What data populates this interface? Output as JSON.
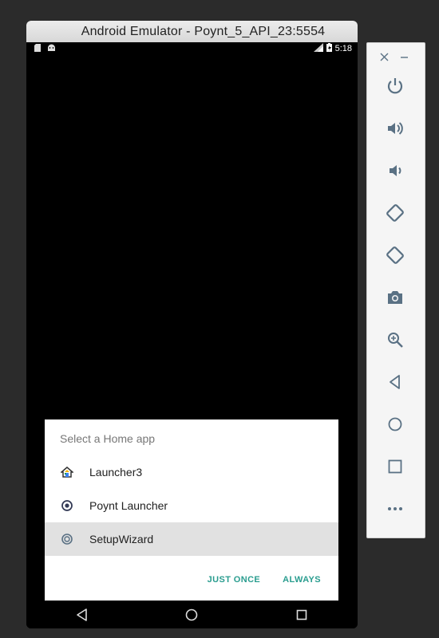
{
  "window": {
    "title": "Android Emulator - Poynt_5_API_23:5554"
  },
  "status_bar": {
    "time": "5:18",
    "left_icons": [
      "sd-card-icon",
      "android-icon"
    ],
    "right_icons": [
      "signal-icon",
      "battery-charging-icon"
    ]
  },
  "dialog": {
    "title": "Select a Home app",
    "items": [
      {
        "label": "Launcher3",
        "icon": "launcher3-icon",
        "selected": false
      },
      {
        "label": "Poynt Launcher",
        "icon": "poynt-icon",
        "selected": false
      },
      {
        "label": "SetupWizard",
        "icon": "setupwizard-icon",
        "selected": true
      }
    ],
    "buttons": {
      "just_once": "JUST ONCE",
      "always": "ALWAYS"
    }
  },
  "navigation_bar": [
    "back-icon",
    "home-icon",
    "recents-icon"
  ],
  "toolbar": {
    "window_controls": [
      "close-icon",
      "minimize-icon"
    ],
    "buttons": [
      "power-icon",
      "volume-up-icon",
      "volume-down-icon",
      "rotate-left-icon",
      "rotate-right-icon",
      "camera-icon",
      "zoom-icon",
      "back-icon",
      "home-icon",
      "overview-icon",
      "more-icon"
    ]
  },
  "colors": {
    "accent": "#2a9d8f",
    "toolbar_icon": "#5a7184",
    "selected_row": "#e1e1e1"
  }
}
